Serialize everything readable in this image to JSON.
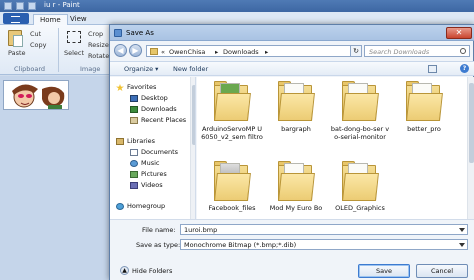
{
  "paint": {
    "title": "iu r - Paint",
    "tabs": [
      "Home",
      "View"
    ],
    "ribbon": {
      "paste": "Paste",
      "cut": "Cut",
      "copy": "Copy",
      "select": "Select",
      "crop": "Crop",
      "resize": "Resize",
      "rotate": "Rotate",
      "clipboard_group": "Clipboard",
      "image_group": "Image"
    }
  },
  "dialog": {
    "title": "Save As",
    "breadcrumb": [
      "OwenChisa",
      "Downloads"
    ],
    "search_placeholder": "Search Downloads",
    "toolbar": {
      "organize": "Organize ▾",
      "new_folder": "New folder"
    },
    "nav": {
      "favorites": "Favorites",
      "desktop": "Desktop",
      "downloads": "Downloads",
      "recent": "Recent Places",
      "libraries": "Libraries",
      "documents": "Documents",
      "music": "Music",
      "pictures": "Pictures",
      "videos": "Videos",
      "homegroup": "Homegroup"
    },
    "files": [
      {
        "name": "ArduinoServoMP U6050_v2_sem filtro"
      },
      {
        "name": "bargraph"
      },
      {
        "name": "bat-dong-bo-ser vo-serial-monitor"
      },
      {
        "name": "better_pro"
      },
      {
        "name": "Facebook_files"
      },
      {
        "name": "Mod My Euro Bo"
      },
      {
        "name": "OLED_Graphics"
      }
    ],
    "file_name_label": "File name:",
    "file_name_value": "1uroi.bmp",
    "save_type_label": "Save as type:",
    "save_type_value": "Monochrome Bitmap (*.bmp;*.dib)",
    "hide_folders": "Hide Folders",
    "save_button": "Save",
    "cancel_button": "Cancel"
  }
}
